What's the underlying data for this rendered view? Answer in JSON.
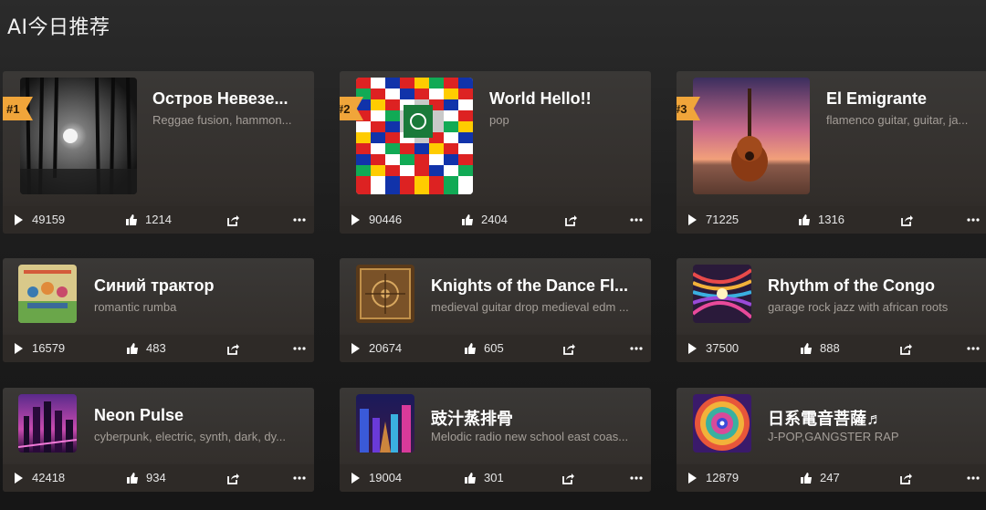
{
  "page": {
    "title": "AI今日推荐"
  },
  "cards": [
    {
      "rank": "#1",
      "title": "Остров Невезе...",
      "subtitle": "Reggae fusion, hammon...",
      "plays": "49159",
      "likes": "1214"
    },
    {
      "rank": "#2",
      "title": "World Hello!!",
      "subtitle": "pop",
      "plays": "90446",
      "likes": "2404"
    },
    {
      "rank": "#3",
      "title": "El Emigrante",
      "subtitle": "flamenco guitar, guitar, ja...",
      "plays": "71225",
      "likes": "1316"
    },
    {
      "title": "Синий трактор",
      "subtitle": "romantic rumba",
      "plays": "16579",
      "likes": "483"
    },
    {
      "title": "Knights of the Dance Fl...",
      "subtitle": "medieval guitar drop medieval edm ...",
      "plays": "20674",
      "likes": "605"
    },
    {
      "title": "Rhythm of the Congo",
      "subtitle": "garage rock jazz with african roots",
      "plays": "37500",
      "likes": "888"
    },
    {
      "title": "Neon Pulse",
      "subtitle": "cyberpunk, electric, synth, dark, dy...",
      "plays": "42418",
      "likes": "934"
    },
    {
      "title": "豉汁蒸排骨",
      "subtitle": "Melodic radio new school east coas...",
      "plays": "19004",
      "likes": "301"
    },
    {
      "title": "日系電音菩薩♬",
      "subtitle": "J-POP,GANGSTER RAP",
      "plays": "12879",
      "likes": "247"
    }
  ],
  "icons": {
    "play": "play-icon",
    "like": "thumbs-up-icon",
    "share": "share-icon",
    "more": "more-icon"
  },
  "colors": {
    "rank_badge": "#f0a53a",
    "subtitle": "#a49e98"
  }
}
